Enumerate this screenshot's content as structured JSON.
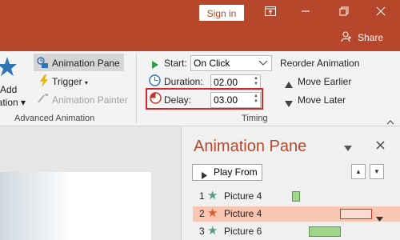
{
  "titlebar": {
    "signin_label": "Sign in",
    "restore_icon": "ribbon-display-icon",
    "colors": {
      "accent": "#b7472a"
    }
  },
  "share_label": "Share",
  "ribbon": {
    "add_label": "Add",
    "add_sub_label": "nation",
    "animation_pane_label": "Animation Pane",
    "trigger_label": "Trigger",
    "animation_painter_label": "Animation Painter",
    "advanced_group_label": "Advanced Animation",
    "start_label": "Start:",
    "start_value": "On Click",
    "duration_label": "Duration:",
    "duration_value": "02.00",
    "delay_label": "Delay:",
    "delay_value": "03.00",
    "timing_group_label": "Timing",
    "reorder_label": "Reorder Animation",
    "move_earlier_label": "Move Earlier",
    "move_later_label": "Move Later"
  },
  "pane": {
    "title": "Animation Pane",
    "play_from_label": "Play From",
    "items": [
      {
        "num": "1",
        "label": "Picture 4",
        "star_color": "#5b9b84"
      },
      {
        "num": "2",
        "label": "Picture 4",
        "star_color": "#d9602a"
      },
      {
        "num": "3",
        "label": "Picture 6",
        "star_color": "#5b9b84"
      }
    ]
  }
}
